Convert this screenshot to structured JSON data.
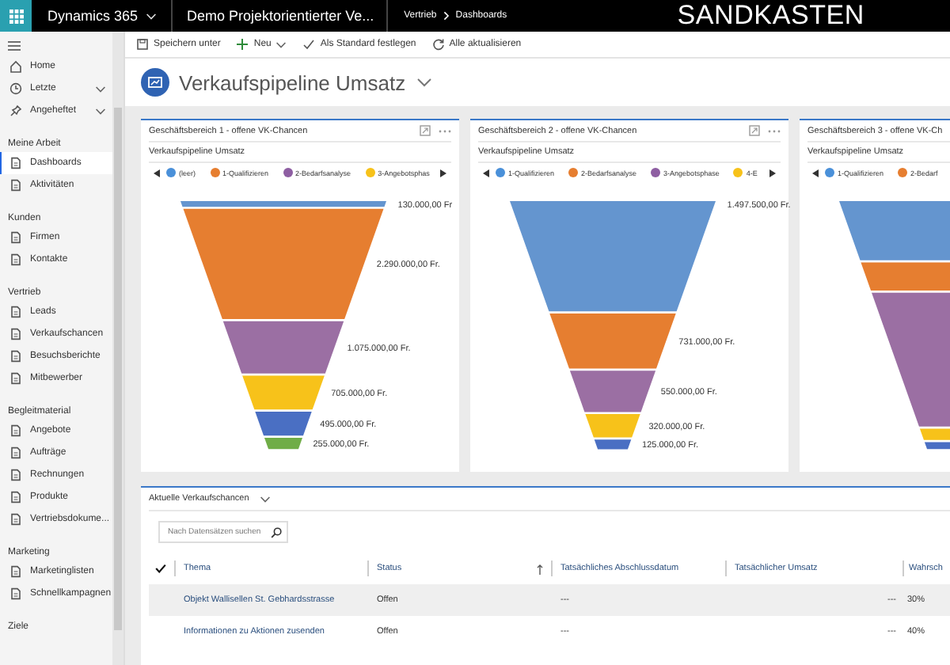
{
  "top_bar": {
    "app_name": "Dynamics 365",
    "app_title": "Demo Projektorientierter Ve...",
    "breadcrumb": [
      "Vertrieb",
      "Dashboards"
    ],
    "environment": "SANDKASTEN"
  },
  "command_bar": [
    {
      "label": "Speichern unter",
      "kind": "save",
      "dropdown": false
    },
    {
      "label": "Neu",
      "kind": "add",
      "dropdown": true
    },
    {
      "label": "Als Standard festlegen",
      "kind": "check",
      "dropdown": false
    },
    {
      "label": "Alle aktualisieren",
      "kind": "refresh",
      "dropdown": false
    }
  ],
  "sidebar": {
    "top_items": [
      {
        "label": "Home",
        "expandable": false
      },
      {
        "label": "Letzte",
        "expandable": true
      },
      {
        "label": "Angeheftet",
        "expandable": true
      }
    ],
    "groups": [
      {
        "title": "Meine Arbeit",
        "items": [
          {
            "label": "Dashboards",
            "selected": true
          },
          {
            "label": "Aktivitäten",
            "selected": false
          }
        ]
      },
      {
        "title": "Kunden",
        "items": [
          {
            "label": "Firmen",
            "selected": false
          },
          {
            "label": "Kontakte",
            "selected": false
          }
        ]
      },
      {
        "title": "Vertrieb",
        "items": [
          {
            "label": "Leads",
            "selected": false
          },
          {
            "label": "Verkaufschancen",
            "selected": false
          },
          {
            "label": "Besuchsberichte",
            "selected": false
          },
          {
            "label": "Mitbewerber",
            "selected": false
          }
        ]
      },
      {
        "title": "Begleitmaterial",
        "items": [
          {
            "label": "Angebote",
            "selected": false
          },
          {
            "label": "Aufträge",
            "selected": false
          },
          {
            "label": "Rechnungen",
            "selected": false
          },
          {
            "label": "Produkte",
            "selected": false
          },
          {
            "label": "Vertriebsdokume...",
            "selected": false
          }
        ]
      },
      {
        "title": "Marketing",
        "items": [
          {
            "label": "Marketinglisten",
            "selected": false
          },
          {
            "label": "Schnellkampagnen",
            "selected": false
          }
        ]
      },
      {
        "title": "Ziele"
      }
    ]
  },
  "dashboard": {
    "title": "Verkaufspipeline Umsatz"
  },
  "panels": [
    {
      "title": "Geschäftsbereich 1 - offene VK-Chancen",
      "subtitle": "Verkaufspipeline Umsatz",
      "legend": [
        {
          "label": "(leer)",
          "color": "#4a90d9"
        },
        {
          "label": "1-Qualifizieren",
          "color": "#e67e30"
        },
        {
          "label": "2-Bedarfsanalyse",
          "color": "#8e5ea2"
        },
        {
          "label": "3-Angebotsphas",
          "color": "#f7c21a"
        }
      ],
      "segments": [
        {
          "color": "#6495cf",
          "value_label": "130.000,00 Fr"
        },
        {
          "color": "#e67e30",
          "value_label": "2.290.000,00 Fr."
        },
        {
          "color": "#9b6fa3",
          "value_label": "1.075.000,00 Fr."
        },
        {
          "color": "#f7c21a",
          "value_label": "705.000,00 Fr."
        },
        {
          "color": "#4a6fc3",
          "value_label": "495.000,00 Fr."
        },
        {
          "color": "#70ad47",
          "value_label": "255.000,00 Fr."
        }
      ]
    },
    {
      "title": "Geschäftsbereich 2 - offene VK-Chancen",
      "subtitle": "Verkaufspipeline Umsatz",
      "legend": [
        {
          "label": "1-Qualifizieren",
          "color": "#4a90d9"
        },
        {
          "label": "2-Bedarfsanalyse",
          "color": "#e67e30"
        },
        {
          "label": "3-Angebotsphase",
          "color": "#8e5ea2"
        },
        {
          "label": "4-E",
          "color": "#f7c21a"
        }
      ],
      "segments": [
        {
          "color": "#6495cf",
          "value_label": "1.497.500,00 Fr."
        },
        {
          "color": "#e67e30",
          "value_label": "731.000,00 Fr."
        },
        {
          "color": "#9b6fa3",
          "value_label": "550.000,00 Fr."
        },
        {
          "color": "#f7c21a",
          "value_label": "320.000,00 Fr."
        },
        {
          "color": "#4a6fc3",
          "value_label": "125.000,00 Fr."
        }
      ]
    },
    {
      "title": "Geschäftsbereich 3 - offene VK-Ch",
      "subtitle": "Verkaufspipeline Umsatz",
      "legend": [
        {
          "label": "1-Qualifizieren",
          "color": "#4a90d9"
        },
        {
          "label": "2-Bedarf",
          "color": "#e67e30"
        }
      ],
      "segments": [
        {
          "color": "#6495cf"
        },
        {
          "color": "#e67e30"
        },
        {
          "color": "#9b6fa3"
        },
        {
          "color": "#f7c21a"
        },
        {
          "color": "#4a6fc3"
        }
      ]
    }
  ],
  "list": {
    "title": "Aktuelle Verkaufschancen",
    "search": {
      "placeholder": "Nach Datensätzen suchen"
    },
    "columns": [
      {
        "label": "Thema",
        "sorted": false
      },
      {
        "label": "Status",
        "sorted": true
      },
      {
        "label": "Tatsächliches Abschlussdatum",
        "sorted": false
      },
      {
        "label": "Tatsächlicher Umsatz",
        "sorted": false
      },
      {
        "label": "Wahrsch",
        "sorted": false
      }
    ],
    "rows": [
      {
        "selected": true,
        "cells": [
          "Objekt Wallisellen St. Gebhardsstrasse",
          "Offen",
          "---",
          "---",
          "30%"
        ]
      },
      {
        "selected": false,
        "cells": [
          "Informationen zu Aktionen zusenden",
          "Offen",
          "---",
          "---",
          "40%"
        ]
      }
    ]
  }
}
